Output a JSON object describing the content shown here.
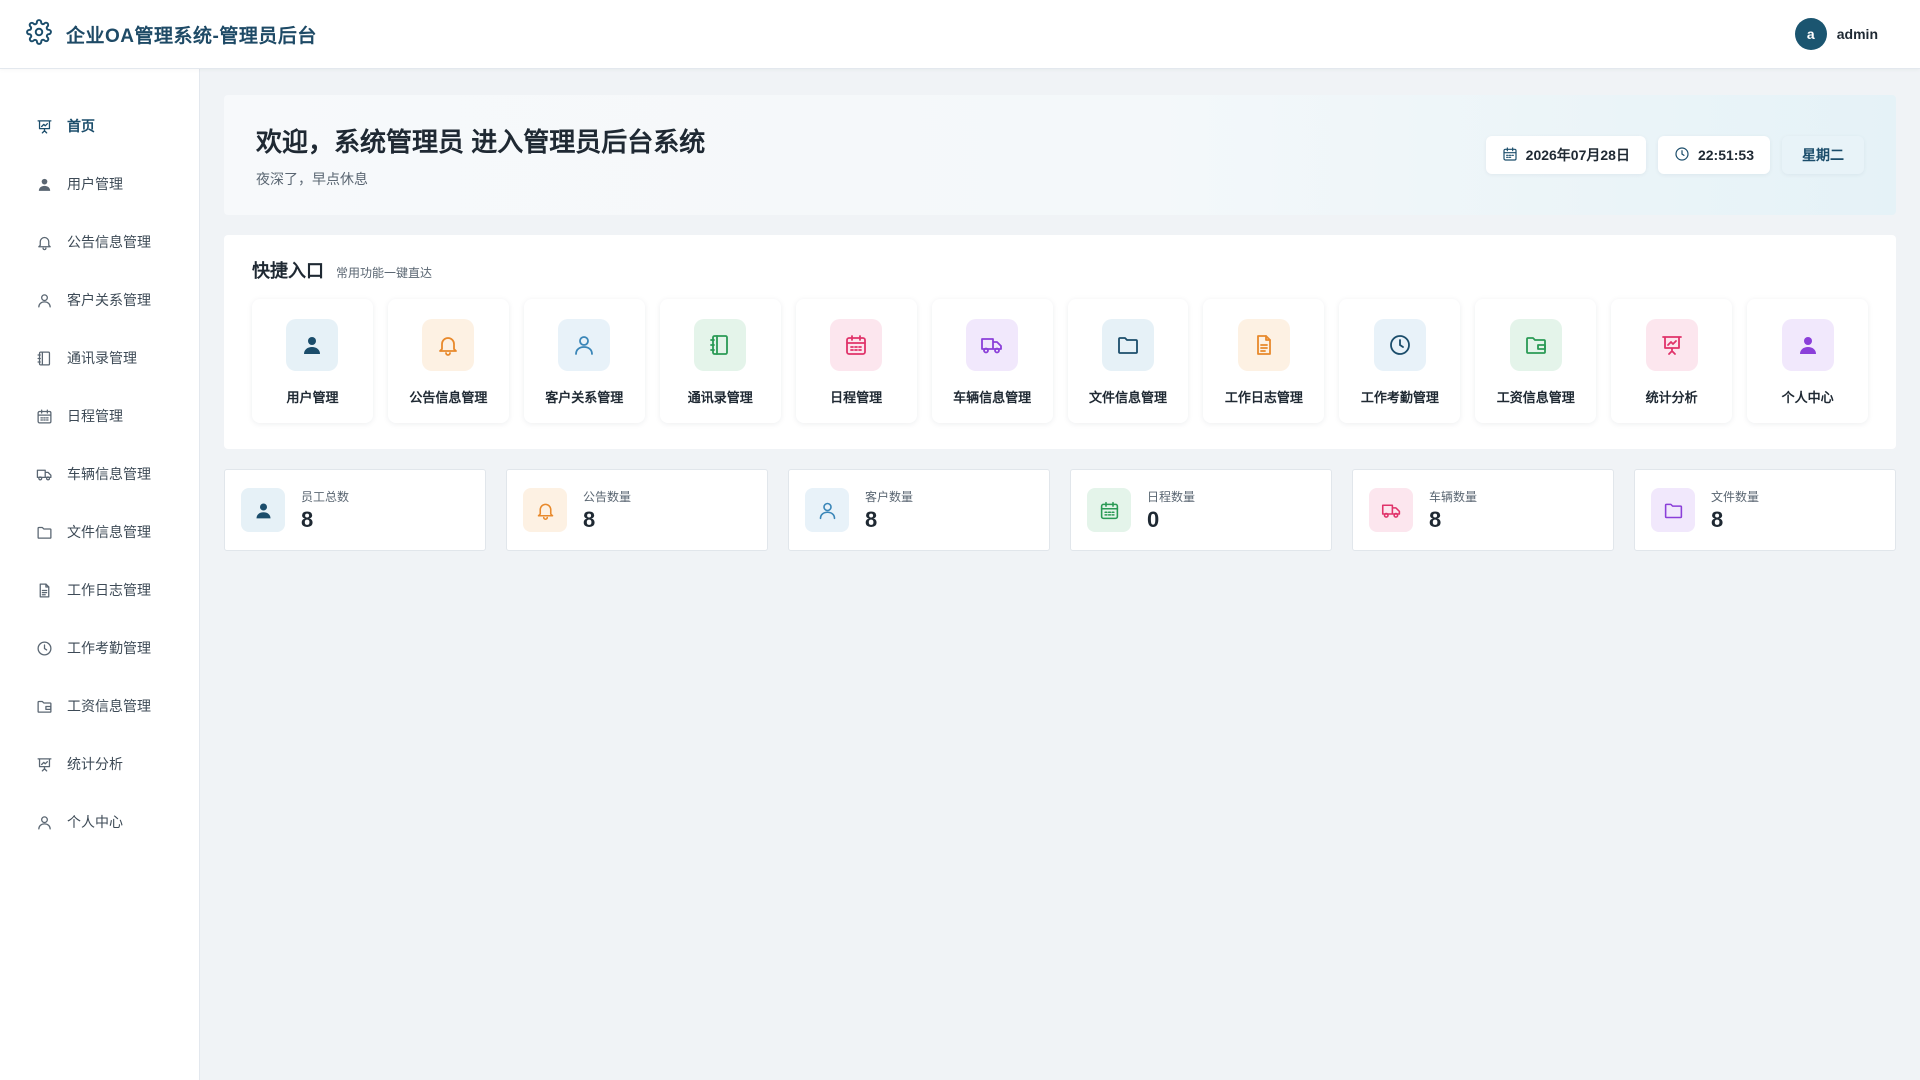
{
  "header": {
    "title": "企业OA管理系统-管理员后台",
    "avatar_letter": "a",
    "username": "admin"
  },
  "sidebar": {
    "items": [
      {
        "label": "首页",
        "icon": "presentation-chart-icon",
        "active": true
      },
      {
        "label": "用户管理",
        "icon": "user-solid-icon"
      },
      {
        "label": "公告信息管理",
        "icon": "bell-icon"
      },
      {
        "label": "客户关系管理",
        "icon": "user-outline-icon"
      },
      {
        "label": "通讯录管理",
        "icon": "notebook-icon"
      },
      {
        "label": "日程管理",
        "icon": "calendar-icon"
      },
      {
        "label": "车辆信息管理",
        "icon": "truck-icon"
      },
      {
        "label": "文件信息管理",
        "icon": "folder-icon"
      },
      {
        "label": "工作日志管理",
        "icon": "document-icon"
      },
      {
        "label": "工作考勤管理",
        "icon": "clock-icon"
      },
      {
        "label": "工资信息管理",
        "icon": "wallet-icon"
      },
      {
        "label": "统计分析",
        "icon": "presentation-chart-icon"
      },
      {
        "label": "个人中心",
        "icon": "user-outline-icon"
      }
    ]
  },
  "welcome": {
    "title": "欢迎，系统管理员 进入管理员后台系统",
    "subtitle": "夜深了，早点休息",
    "date": "2026年07月28日",
    "time": "22:51:53",
    "weekday": "星期二"
  },
  "quick": {
    "title": "快捷入口",
    "subtitle": "常用功能一键直达",
    "tiles": [
      {
        "label": "用户管理",
        "icon": "user-solid-icon",
        "color": "#1b4d6b",
        "bg": "#e6f1f7"
      },
      {
        "label": "公告信息管理",
        "icon": "bell-icon",
        "color": "#e8892b",
        "bg": "#fdf1e3"
      },
      {
        "label": "客户关系管理",
        "icon": "user-outline-icon",
        "color": "#3a86b8",
        "bg": "#e8f2f9"
      },
      {
        "label": "通讯录管理",
        "icon": "notebook-icon",
        "color": "#2a9a55",
        "bg": "#e4f4ea"
      },
      {
        "label": "日程管理",
        "icon": "calendar-icon",
        "color": "#e0336a",
        "bg": "#fce6ee"
      },
      {
        "label": "车辆信息管理",
        "icon": "truck-icon",
        "color": "#8b3fd9",
        "bg": "#f1e8fc"
      },
      {
        "label": "文件信息管理",
        "icon": "folder-icon",
        "color": "#1b4d6b",
        "bg": "#e6f1f7"
      },
      {
        "label": "工作日志管理",
        "icon": "document-icon",
        "color": "#e8892b",
        "bg": "#fdf1e3"
      },
      {
        "label": "工作考勤管理",
        "icon": "clock-icon",
        "color": "#1b4d6b",
        "bg": "#e8f2f9"
      },
      {
        "label": "工资信息管理",
        "icon": "wallet-icon",
        "color": "#2a9a55",
        "bg": "#e4f4ea"
      },
      {
        "label": "统计分析",
        "icon": "presentation-chart-icon",
        "color": "#e0336a",
        "bg": "#fce6ee"
      },
      {
        "label": "个人中心",
        "icon": "user-solid-icon",
        "color": "#8b3fd9",
        "bg": "#f1e8fc"
      }
    ]
  },
  "stats": [
    {
      "label": "员工总数",
      "value": "8",
      "icon": "user-solid-icon",
      "color": "#1b4d6b",
      "bg": "#e6f1f7"
    },
    {
      "label": "公告数量",
      "value": "8",
      "icon": "bell-icon",
      "color": "#e8892b",
      "bg": "#fdf1e3"
    },
    {
      "label": "客户数量",
      "value": "8",
      "icon": "user-outline-icon",
      "color": "#3a86b8",
      "bg": "#e8f2f9"
    },
    {
      "label": "日程数量",
      "value": "0",
      "icon": "calendar-icon",
      "color": "#2a9a55",
      "bg": "#e4f4ea"
    },
    {
      "label": "车辆数量",
      "value": "8",
      "icon": "truck-icon",
      "color": "#e0336a",
      "bg": "#fce6ee"
    },
    {
      "label": "文件数量",
      "value": "8",
      "icon": "folder-icon",
      "color": "#8b3fd9",
      "bg": "#f1e8fc"
    }
  ],
  "colors": {
    "brand": "#1b4d6b",
    "sidebar_icon": "#5a6672"
  }
}
